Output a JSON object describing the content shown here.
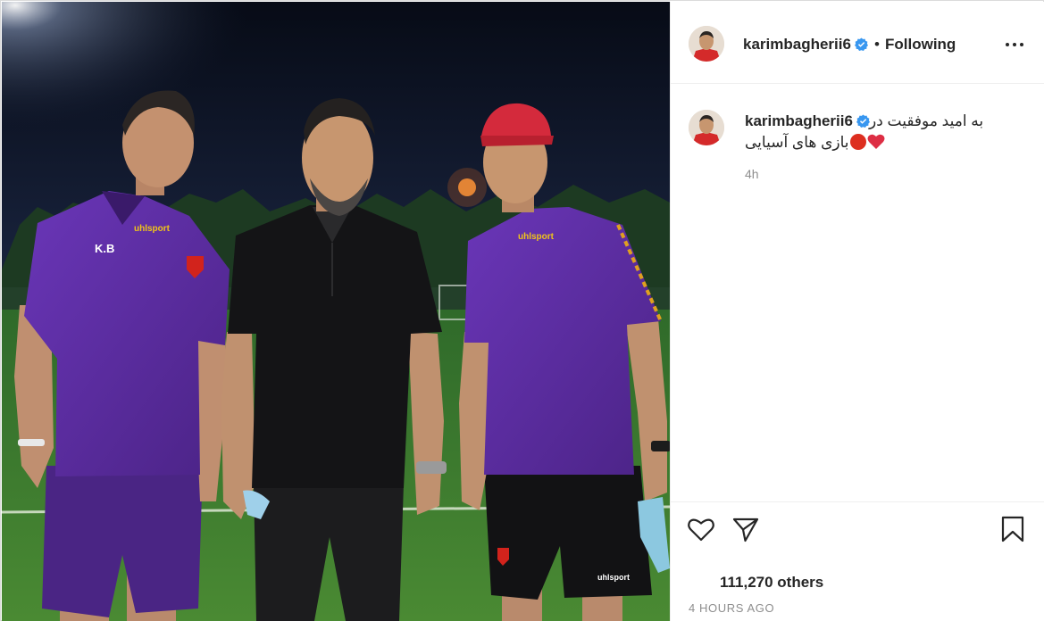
{
  "post": {
    "username": "karimbagherii6",
    "follow_status": "Following",
    "separator": "•",
    "photo_alt": "Three men on a football pitch at night",
    "jersey_initials": "K.B",
    "jersey_brand": "uhlsport"
  },
  "caption": {
    "username": "karimbagherii6",
    "line1": "به امید موفقیت در",
    "line2": "بازی های آسیایی",
    "time_short": "4h"
  },
  "actions": {
    "likes_text": "111,270 others",
    "time_ago": "4 HOURS AGO"
  },
  "colors": {
    "verified": "#3897f0",
    "jersey_purple": "#5e2ea3",
    "pitch_green": "#3f7d2c",
    "text_primary": "#262626",
    "text_secondary": "#8e8e8e"
  },
  "icons": {
    "more": "more-options-icon",
    "like": "heart-icon",
    "share": "paper-plane-icon",
    "save": "bookmark-icon",
    "verified": "verified-badge-icon"
  }
}
